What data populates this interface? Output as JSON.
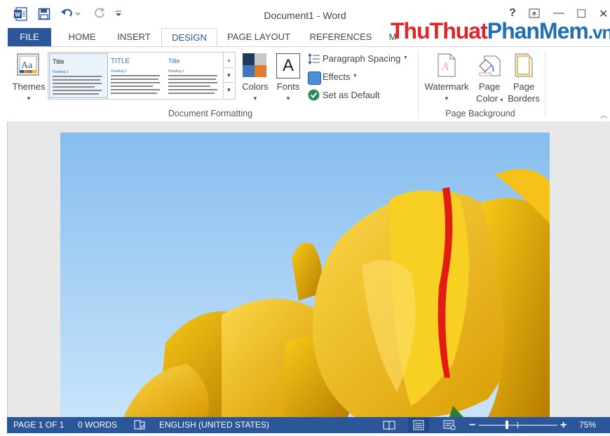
{
  "window": {
    "title": "Document1 - Word",
    "help": "?",
    "minimize": "—",
    "maximize": "☐",
    "close": "✕"
  },
  "quick_access": {
    "app_icon": "word-icon",
    "save": "save-icon",
    "undo": "undo-icon",
    "redo": "redo-icon",
    "customize": "customize-icon"
  },
  "tabs": [
    "FILE",
    "HOME",
    "INSERT",
    "DESIGN",
    "PAGE LAYOUT",
    "REFERENCES",
    "M"
  ],
  "overlay_watermark": {
    "part1": "ThuThuat",
    "part2": "PhanMem",
    "part3": ".vn"
  },
  "ribbon": {
    "themes": "Themes",
    "styles": [
      {
        "title": "Title",
        "heading": "Heading 1"
      },
      {
        "title": "TITLE",
        "heading": "Heading 1"
      },
      {
        "title": "Title",
        "heading": "Heading 1"
      }
    ],
    "colors": "Colors",
    "fonts": "Fonts",
    "fonts_glyph": "A",
    "paragraph_spacing": "Paragraph Spacing",
    "effects": "Effects",
    "set_default": "Set as Default",
    "group_document_formatting": "Document Formatting",
    "watermark": "Watermark",
    "page_color": [
      "Page",
      "Color"
    ],
    "page_borders": [
      "Page",
      "Borders"
    ],
    "group_page_background": "Page Background"
  },
  "status": {
    "page": "PAGE 1 OF 1",
    "words": "0 WORDS",
    "language": "ENGLISH (UNITED STATES)",
    "zoom": "75%",
    "zoom_minus": "−",
    "zoom_plus": "+",
    "zoom_level": 0.75
  },
  "colors": {
    "accent": "#2b579a",
    "sky": "#a9d3f3",
    "tulip": "#f2c20f"
  }
}
